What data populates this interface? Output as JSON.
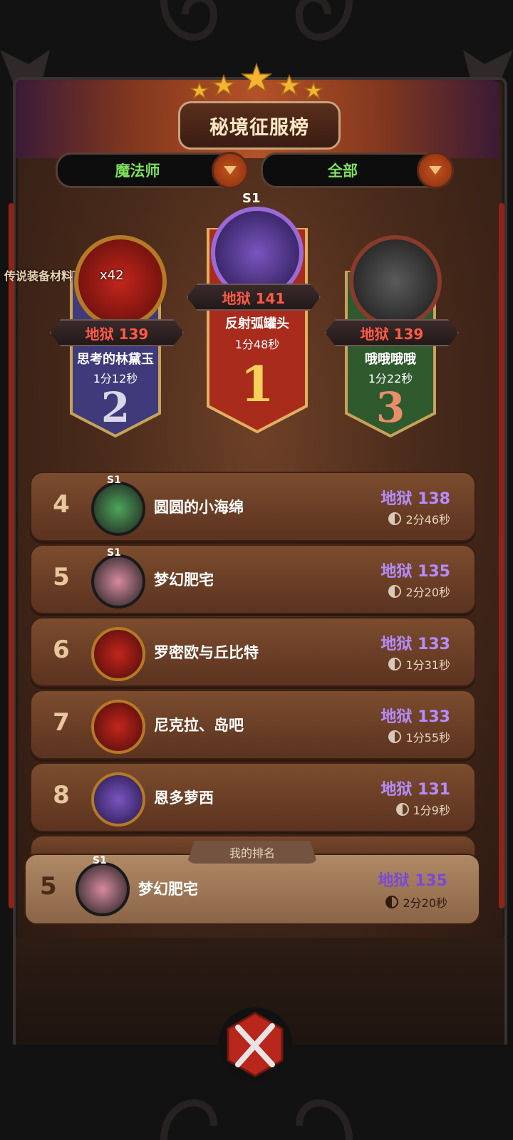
{
  "header": {
    "title": "秘境征服榜"
  },
  "filters": {
    "class_label": "魔法师",
    "scope_label": "全部"
  },
  "tooltip": {
    "text": "传说装备材料",
    "count": "x42"
  },
  "podium": [
    {
      "rank_label": "1",
      "season": "S1",
      "difficulty": "地狱 141",
      "name": "反射弧罐头",
      "time": "1分48秒"
    },
    {
      "rank_label": "2",
      "difficulty": "地狱 139",
      "name": "思考的林黛玉",
      "time": "1分12秒"
    },
    {
      "rank_label": "3",
      "difficulty": "地狱 139",
      "name": "哦哦哦哦",
      "time": "1分22秒"
    }
  ],
  "rows": [
    {
      "rank": "4",
      "season": "S1",
      "name": "圆圆的小海绵",
      "difficulty": "地狱 138",
      "time": "2分46秒"
    },
    {
      "rank": "5",
      "season": "S1",
      "name": "梦幻肥宅",
      "difficulty": "地狱 135",
      "time": "2分20秒"
    },
    {
      "rank": "6",
      "name": "罗密欧与丘比特",
      "difficulty": "地狱 133",
      "time": "1分31秒"
    },
    {
      "rank": "7",
      "name": "尼克拉、岛吧",
      "difficulty": "地狱 133",
      "time": "1分55秒"
    },
    {
      "rank": "8",
      "name": "恩多萝西",
      "difficulty": "地狱 131",
      "time": "1分9秒"
    }
  ],
  "my_rank": {
    "label": "我的排名",
    "rank": "5",
    "season": "S1",
    "name": "梦幻肥宅",
    "difficulty": "地狱 135",
    "time": "2分20秒"
  },
  "colors": {
    "difficulty_podium": "#ff5a47",
    "difficulty_row": "#b58cff",
    "filter_text": "#7ee05e"
  }
}
